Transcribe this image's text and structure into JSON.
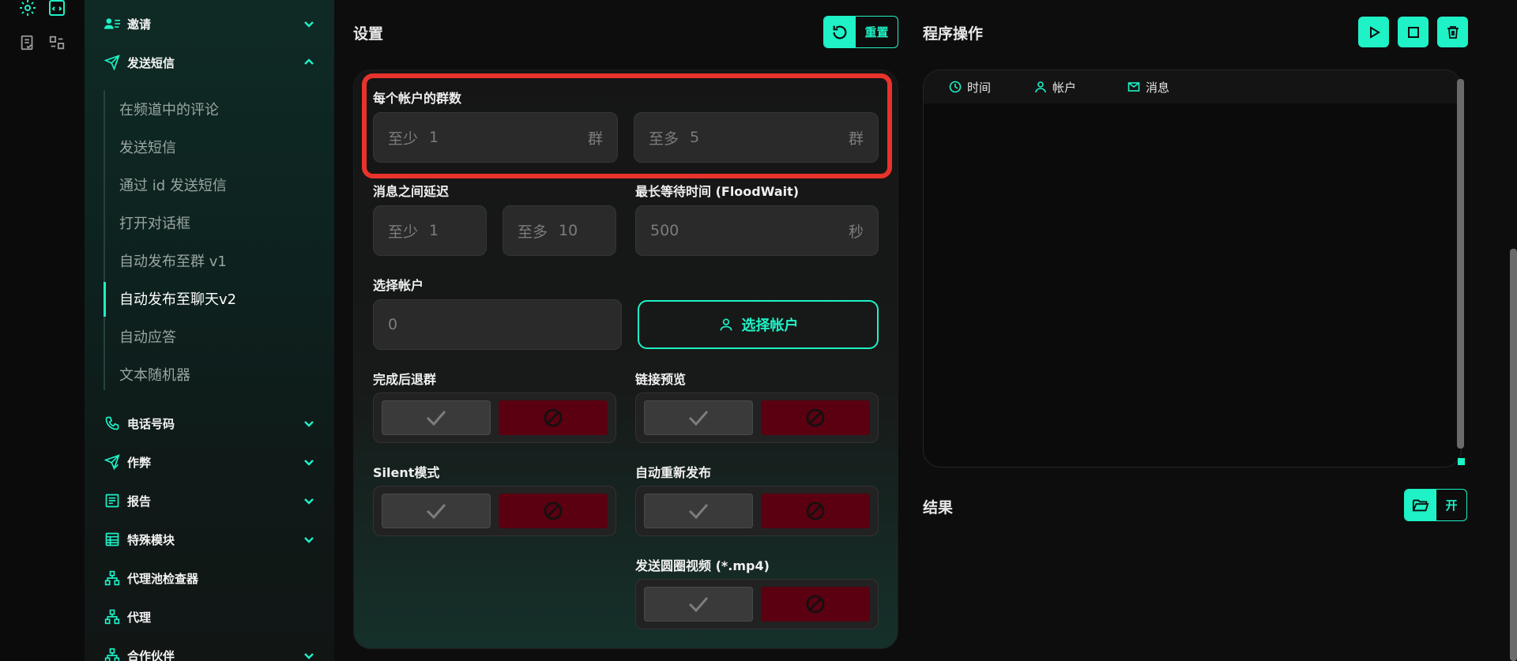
{
  "sidebar": {
    "sections": [
      {
        "label": "邀请",
        "icon": "users-list-icon",
        "expanded": false
      },
      {
        "label": "发送短信",
        "icon": "send-icon",
        "expanded": true
      },
      {
        "label": "电话号码",
        "icon": "phone-icon",
        "expanded": false
      },
      {
        "label": "作弊",
        "icon": "send-check-icon",
        "expanded": false
      },
      {
        "label": "报告",
        "icon": "report-icon",
        "expanded": false
      },
      {
        "label": "特殊模块",
        "icon": "table-icon",
        "expanded": false
      },
      {
        "label": "代理池检查器",
        "icon": "network-icon",
        "expanded": false
      },
      {
        "label": "代理",
        "icon": "network-icon",
        "expanded": false
      },
      {
        "label": "合作伙伴",
        "icon": "network-icon",
        "expanded": false
      }
    ],
    "sub_items": [
      {
        "label": "在频道中的评论"
      },
      {
        "label": "发送短信"
      },
      {
        "label": "通过 id 发送短信"
      },
      {
        "label": "打开对话框"
      },
      {
        "label": "自动发布至群 v1"
      },
      {
        "label": "自动发布至聊天v2",
        "active": true
      },
      {
        "label": "自动应答"
      },
      {
        "label": "文本随机器"
      }
    ]
  },
  "settings": {
    "title": "设置",
    "reset_label": "重置",
    "groups_per_account": {
      "label": "每个帐户的群数",
      "min_prefix": "至少",
      "min_value": "1",
      "min_suffix": "群",
      "max_prefix": "至多",
      "max_value": "5",
      "max_suffix": "群"
    },
    "delay": {
      "label": "消息之间延迟",
      "min_prefix": "至少",
      "min_value": "1",
      "max_prefix": "至多",
      "max_value": "10"
    },
    "flood_wait": {
      "label": "最长等待时间 (FloodWait)",
      "value": "500",
      "suffix": "秒"
    },
    "select_accounts": {
      "label": "选择帐户",
      "value": "0",
      "button": "选择帐户"
    },
    "toggles": {
      "leave_after": "完成后退群",
      "link_preview": "链接预览",
      "silent_mode": "Silent模式",
      "auto_repost": "自动重新发布",
      "round_video": "发送圆圈视频 (*.mp4)"
    }
  },
  "operations": {
    "title": "程序操作",
    "columns": [
      "时间",
      "帐户",
      "消息"
    ],
    "result_title": "结果",
    "open_label": "开"
  },
  "colors": {
    "accent": "#1ef2c6",
    "danger": "#5a0010",
    "highlight": "#e8332c"
  }
}
